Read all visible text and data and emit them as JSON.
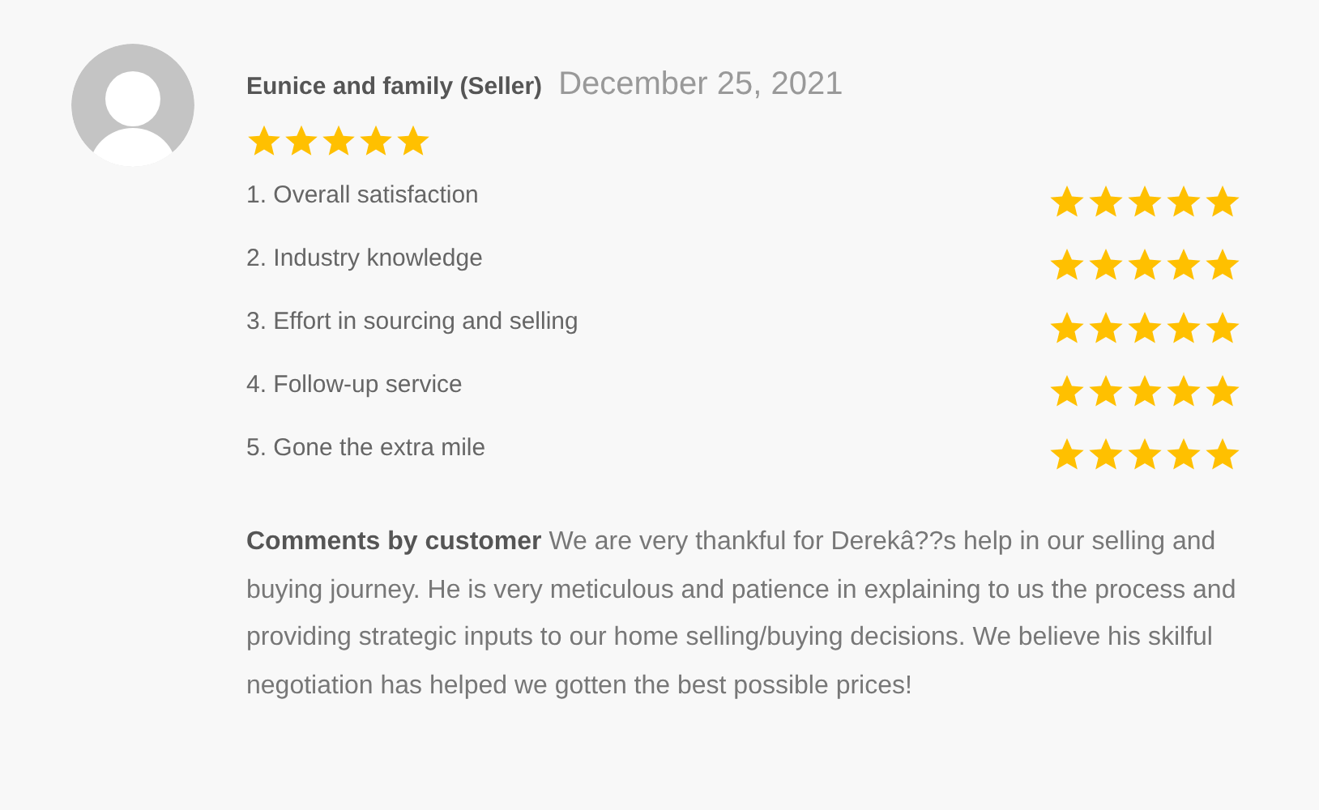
{
  "review": {
    "reviewer": "Eunice and family (Seller)",
    "date": "December 25, 2021",
    "stars": 5,
    "criteria": [
      {
        "label": "1. Overall satisfaction",
        "stars": 5
      },
      {
        "label": "2. Industry knowledge",
        "stars": 5
      },
      {
        "label": "3. Effort in sourcing and selling",
        "stars": 5
      },
      {
        "label": "4. Follow-up service",
        "stars": 5
      },
      {
        "label": "5. Gone the extra mile",
        "stars": 5
      }
    ],
    "comment": "**Comments by customer**  We are very thankful for Derekâ??s help in our selling and buying journey. He is very meticulous and patience in explaining to us the process and providing strategic inputs to our home selling/buying decisions. We believe his skilful negotiation has helped we gotten the best possible prices!"
  }
}
